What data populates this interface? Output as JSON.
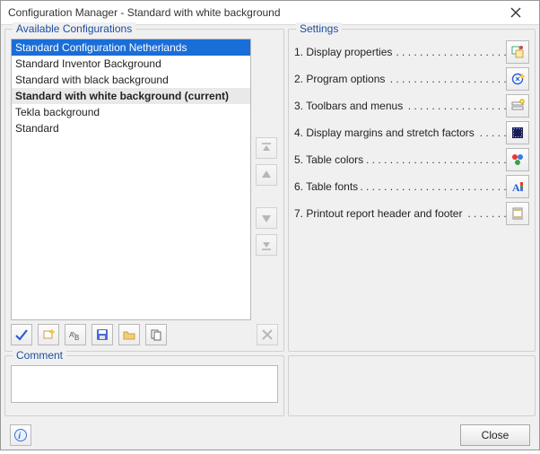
{
  "window": {
    "title": "Configuration Manager - Standard with white background"
  },
  "left": {
    "title": "Available Configurations",
    "items": [
      {
        "label": "Standard Configuration Netherlands",
        "selected": true,
        "current": false
      },
      {
        "label": "Standard Inventor Background",
        "selected": false,
        "current": false
      },
      {
        "label": "Standard with black background",
        "selected": false,
        "current": false
      },
      {
        "label": "Standard with white background (current)",
        "selected": false,
        "current": true
      },
      {
        "label": "Tekla background",
        "selected": false,
        "current": false
      },
      {
        "label": "Standard",
        "selected": false,
        "current": false
      }
    ]
  },
  "right": {
    "title": "Settings",
    "items": [
      {
        "num": "1",
        "label": "Display properties"
      },
      {
        "num": "2",
        "label": "Program options"
      },
      {
        "num": "3",
        "label": "Toolbars and menus"
      },
      {
        "num": "4",
        "label": "Display margins and stretch factors"
      },
      {
        "num": "5",
        "label": "Table colors"
      },
      {
        "num": "6",
        "label": "Table fonts"
      },
      {
        "num": "7",
        "label": "Printout report header and footer"
      }
    ]
  },
  "comment": {
    "title": "Comment",
    "value": ""
  },
  "buttons": {
    "close": "Close"
  }
}
